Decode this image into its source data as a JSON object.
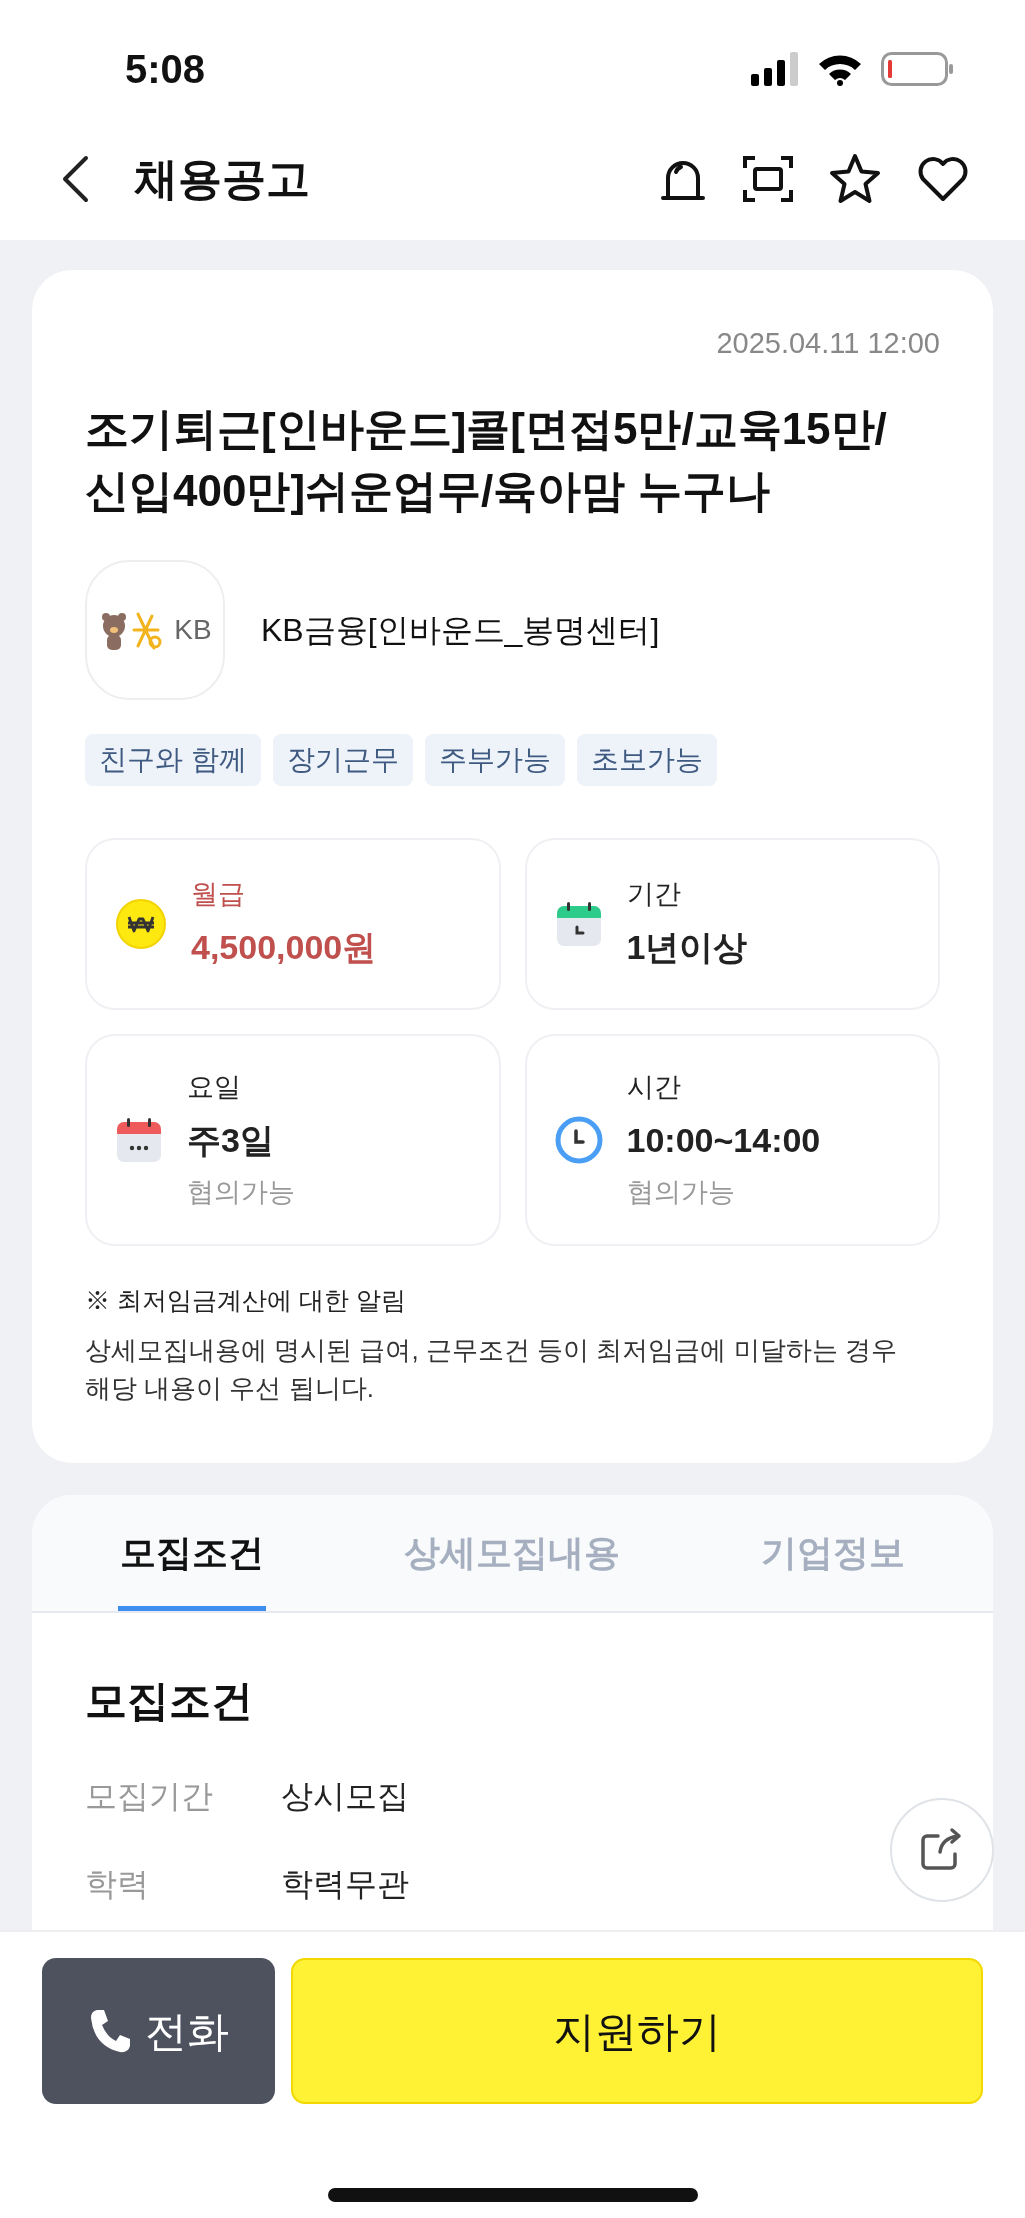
{
  "status_bar": {
    "time": "5:08"
  },
  "header": {
    "title": "채용공고"
  },
  "posting": {
    "date": "2025.04.11 12:00",
    "title": "조기퇴근[인바운드]콜[면접5만/교육15만/신입400만]쉬운업무/육아맘 누구나",
    "logo_text": "KB",
    "company": "KB금융[인바운드_봉명센터]",
    "tags": [
      "친구와 함께",
      "장기근무",
      "주부가능",
      "초보가능"
    ],
    "info": [
      {
        "kind": "salary",
        "label": "월급",
        "value": "4,500,000원"
      },
      {
        "kind": "period",
        "label": "기간",
        "value": "1년이상"
      },
      {
        "kind": "days",
        "label": "요일",
        "value": "주3일",
        "note": "협의가능"
      },
      {
        "kind": "hours",
        "label": "시간",
        "value": "10:00~14:00",
        "note": "협의가능"
      }
    ],
    "notice": {
      "title": "※ 최저임금계산에 대한 알림",
      "body": "상세모집내용에 명시된 급여, 근무조건 등이 최저임금에 미달하는 경우 해당 내용이 우선 됩니다."
    }
  },
  "tabs": [
    {
      "label": "모집조건",
      "selected": true
    },
    {
      "label": "상세모집내용",
      "selected": false
    },
    {
      "label": "기업정보",
      "selected": false
    }
  ],
  "section": {
    "heading": "모집조건",
    "rows": [
      {
        "label": "모집기간",
        "value": "상시모집"
      },
      {
        "label": "학력",
        "value": "학력무관"
      }
    ]
  },
  "actions": {
    "call": "전화",
    "apply": "지원하기"
  }
}
